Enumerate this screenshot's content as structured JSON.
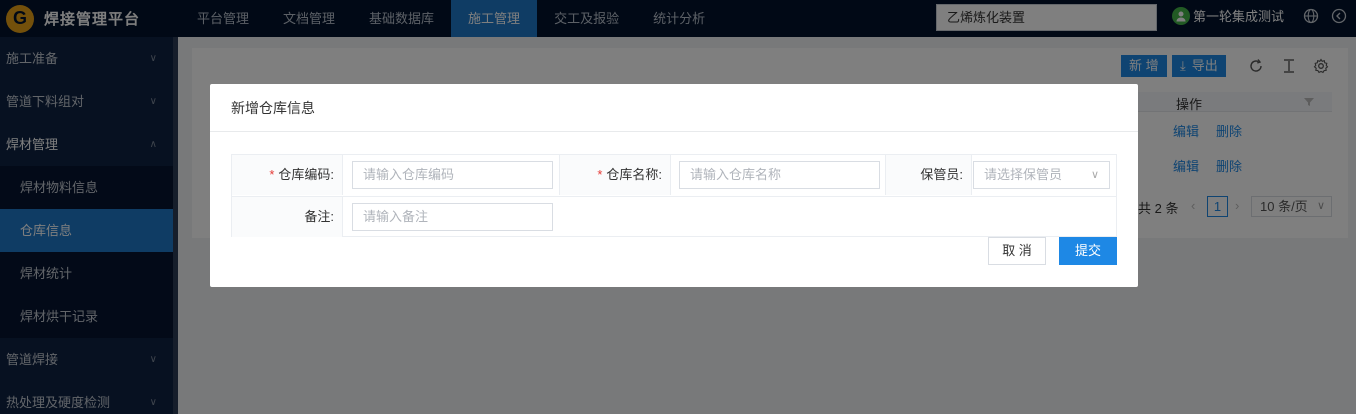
{
  "app": {
    "title": "焊接管理平台",
    "logo_letter": "G"
  },
  "topnav": [
    {
      "label": "平台管理"
    },
    {
      "label": "文档管理"
    },
    {
      "label": "基础数据库"
    },
    {
      "label": "施工管理",
      "active": true
    },
    {
      "label": "交工及报验"
    },
    {
      "label": "统计分析"
    }
  ],
  "project_select": {
    "value": "乙烯炼化装置"
  },
  "user": {
    "name": "第一轮集成测试"
  },
  "sidebar": {
    "items": [
      {
        "label": "施工准备"
      },
      {
        "label": "管道下料组对"
      },
      {
        "label": "焊材管理"
      },
      {
        "label": "焊材物料信息"
      },
      {
        "label": "仓库信息"
      },
      {
        "label": "焊材统计"
      },
      {
        "label": "焊材烘干记录"
      },
      {
        "label": "管道焊接"
      },
      {
        "label": "热处理及硬度检测"
      }
    ]
  },
  "toolbar": {
    "add_label": "新 增",
    "export_label": "导出"
  },
  "table": {
    "action_header": "操作",
    "rows": [
      {
        "edit": "编辑",
        "delete": "删除"
      },
      {
        "edit": "编辑",
        "delete": "删除"
      }
    ]
  },
  "pager": {
    "total": "共 2 条",
    "current_page": "1",
    "page_size": "10 条/页"
  },
  "modal": {
    "title": "新增仓库信息",
    "fields": {
      "code_label": "仓库编码:",
      "code_placeholder": "请输入仓库编码",
      "name_label": "仓库名称:",
      "name_placeholder": "请输入仓库名称",
      "keeper_label": "保管员:",
      "keeper_placeholder": "请选择保管员",
      "remark_label": "备注:",
      "remark_placeholder": "请输入备注"
    },
    "required_mark": "*",
    "cancel_label": "取 消",
    "submit_label": "提交"
  },
  "colors": {
    "topbar": "#02132c",
    "accent": "#1e78c8",
    "sidebar": "#0f2343",
    "primary_button": "#1e88e5",
    "required": "#e53935"
  }
}
